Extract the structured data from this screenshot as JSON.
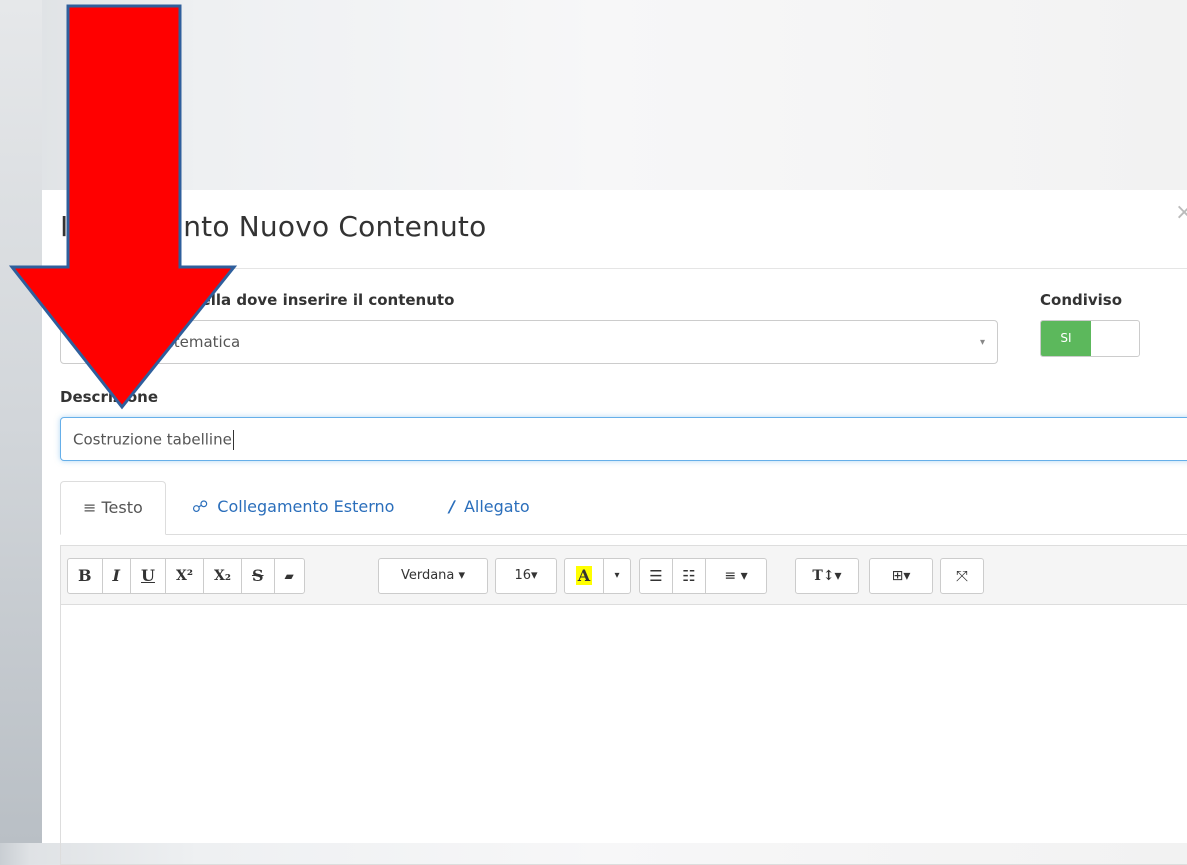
{
  "modal": {
    "title": "Inserimento Nuovo Contenuto",
    "close_glyph": "×"
  },
  "folder": {
    "label": "Seleziona la cartella dove inserire il contenuto",
    "value": "Materiale matematica",
    "caret": "▾"
  },
  "shared": {
    "label": "Condiviso",
    "on_label": "SI"
  },
  "description": {
    "label": "Descrizione",
    "value": "Costruzione tabelline"
  },
  "tabs": [
    {
      "label": "Testo",
      "icon": "align-left-icon",
      "glyph": "≡"
    },
    {
      "label": "Collegamento Esterno",
      "icon": "link-icon",
      "glyph": "🔗"
    },
    {
      "label": "Allegato",
      "icon": "paperclip-icon",
      "glyph": "📎"
    }
  ],
  "toolbar": {
    "bold": "B",
    "italic": "I",
    "underline": "U",
    "superscript": "X²",
    "subscript": "X₂",
    "strikethrough": "S",
    "eraser": "▰",
    "font_family": "Verdana ▾",
    "font_size": "16▾",
    "color": "A",
    "color_caret": "▾",
    "ul": "☰",
    "ol": "☷",
    "align": "≡ ▾",
    "line_height": "T↕▾",
    "table": "⊞▾",
    "fullscreen": "⤧"
  },
  "colors": {
    "toggle_on": "#5cb85c",
    "link": "#2a6ebb",
    "arrow": "#ff0000"
  }
}
